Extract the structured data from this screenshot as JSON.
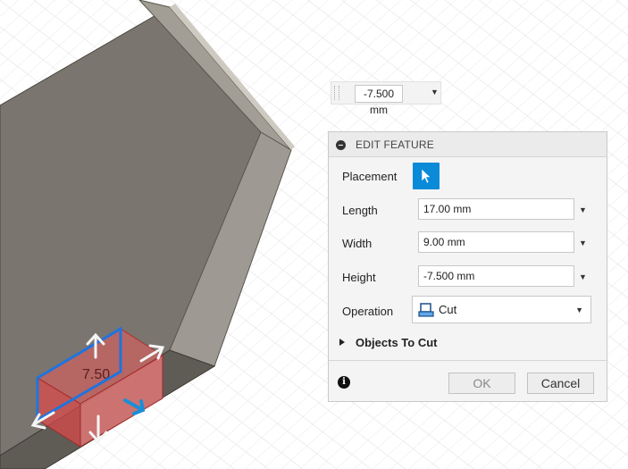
{
  "viewport": {
    "dimension_overlay": "7.50"
  },
  "floating_input": {
    "value": "-7.500 mm"
  },
  "panel": {
    "title": "EDIT FEATURE",
    "placement_label": "Placement",
    "length_label": "Length",
    "length_value": "17.00 mm",
    "width_label": "Width",
    "width_value": "9.00 mm",
    "height_label": "Height",
    "height_value": "-7.500 mm",
    "operation_label": "Operation",
    "operation_value": "Cut",
    "objects_group_label": "Objects To Cut",
    "ok_label": "OK",
    "cancel_label": "Cancel",
    "info_glyph": "i"
  },
  "colors": {
    "accent": "#0b8ad8",
    "cut_preview": "#e84a4a",
    "manipulator_blue": "#1e74e0"
  },
  "icons": [
    "cursor-arrow-icon",
    "collapse-icon",
    "cut-operation-icon",
    "chevron-down-icon",
    "info-icon",
    "expand-triangle-icon"
  ]
}
